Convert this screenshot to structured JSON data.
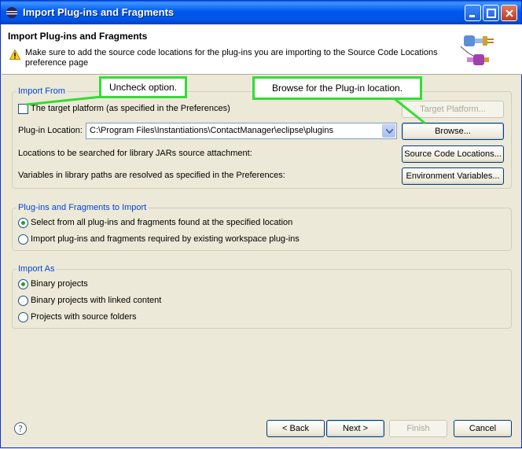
{
  "window": {
    "title": "Import Plug-ins and Fragments"
  },
  "header": {
    "title": "Import Plug-ins and Fragments",
    "message": "Make sure to add the source code locations for the plug-ins you are importing to the Source Code Locations preference page"
  },
  "import_from": {
    "group_label": "Import From",
    "target_platform_checkbox": "The target platform (as specified in the Preferences)",
    "target_platform_checked": false,
    "target_platform_button": "Target Platform...",
    "plugin_location_label": "Plug-in Location:",
    "plugin_location_value": "C:\\Program Files\\Instantiations\\ContactManager\\eclipse\\plugins",
    "browse_button": "Browse...",
    "source_locations_label": "Locations to be searched for library JARs source attachment:",
    "source_locations_button": "Source Code Locations...",
    "env_vars_label": "Variables in library paths are resolved as specified in the Preferences:",
    "env_vars_button": "Environment Variables..."
  },
  "plugins_to_import": {
    "group_label": "Plug-ins and Fragments to Import",
    "options": [
      {
        "label": "Select from all plug-ins and fragments found at the specified location",
        "checked": true
      },
      {
        "label": "Import plug-ins and fragments required by existing workspace plug-ins",
        "checked": false
      }
    ]
  },
  "import_as": {
    "group_label": "Import As",
    "options": [
      {
        "label": "Binary projects",
        "checked": true
      },
      {
        "label": "Binary projects with linked content",
        "checked": false
      },
      {
        "label": "Projects with source folders",
        "checked": false
      }
    ]
  },
  "footer": {
    "back_button": "< Back",
    "next_button": "Next >",
    "finish_button": "Finish",
    "cancel_button": "Cancel"
  },
  "callouts": {
    "uncheck": "Uncheck option.",
    "browse": "Browse for the Plug-in location."
  },
  "colors": {
    "callout_border": "#33dd33",
    "group_label": "#0046d5",
    "titlebar": "#0055e5"
  }
}
